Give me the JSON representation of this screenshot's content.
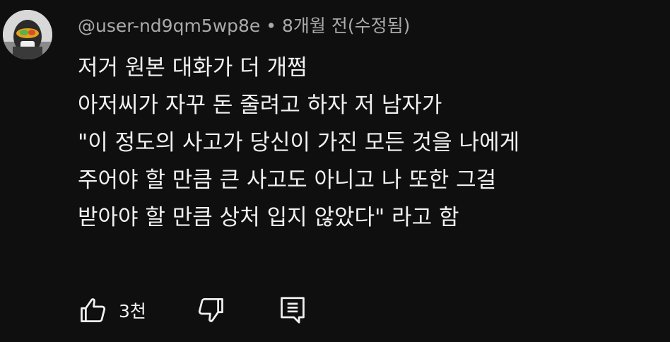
{
  "comment": {
    "author": "@user-nd9qm5wp8e",
    "separator": "•",
    "time": "8개월 전(수정됨)",
    "lines": [
      "저거 원본 대화가 더 개쩜",
      "아저씨가 자꾸 돈 줄려고 하자 저 남자가",
      "\"이 정도의 사고가 당신이 가진 모든 것을 나에게",
      "주어야 할 만큼 큰 사고도 아니고 나 또한 그걸",
      "받아야 할 만큼 상처 입지 않았다\" 라고 함"
    ],
    "like_count": "3천"
  },
  "icons": {
    "avatar": "avatar",
    "like": "thumbs-up-icon",
    "dislike": "thumbs-down-icon",
    "reply": "reply-comment-icon"
  }
}
